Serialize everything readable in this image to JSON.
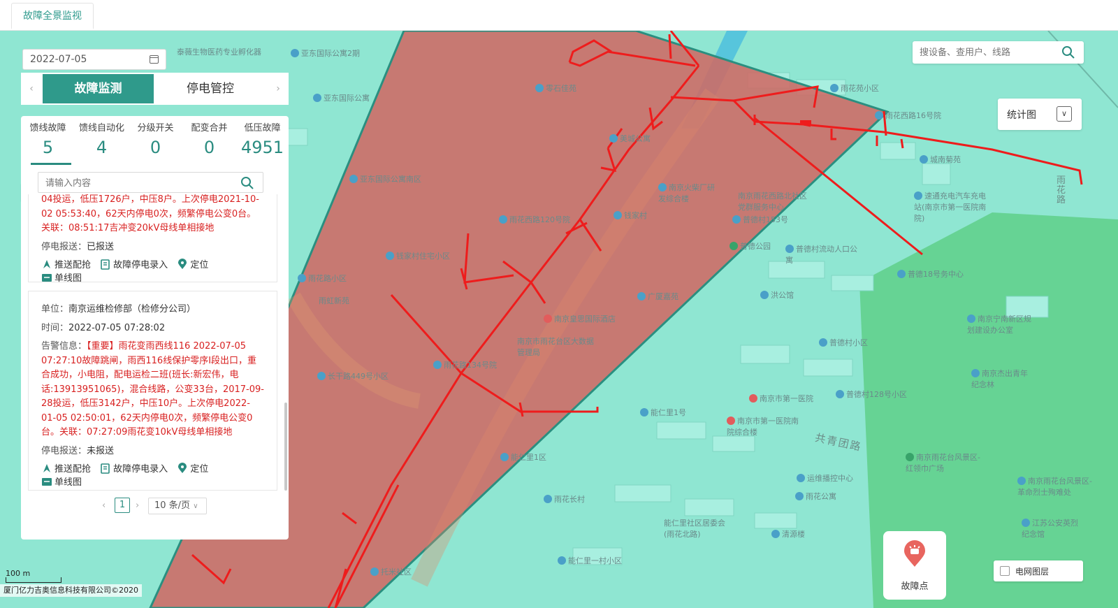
{
  "topbar": {
    "tab_label": "故障全景监视"
  },
  "date_picker": {
    "value": "2022-07-05",
    "icon": "calendar-icon"
  },
  "map_search": {
    "placeholder": "搜设备、查用户、线路",
    "icon": "search-icon"
  },
  "stat_view": {
    "label": "统计图",
    "icon": "chevron-down-icon"
  },
  "panel": {
    "tabs": [
      {
        "label": "故障监测",
        "active": true
      },
      {
        "label": "停电管控",
        "active": false
      }
    ],
    "prev_icon": "chevron-left-icon",
    "next_icon": "chevron-right-icon",
    "stats": [
      {
        "label": "馈线故障",
        "value": "5",
        "active": true
      },
      {
        "label": "馈线自动化",
        "value": "4"
      },
      {
        "label": "分级开关",
        "value": "0"
      },
      {
        "label": "配变合并",
        "value": "0"
      },
      {
        "label": "低压故障",
        "value": "4951"
      }
    ],
    "list_search": {
      "placeholder": "请输入内容"
    },
    "items": [
      {
        "alarm_tail": "04投运，低压1726户，中压8户。上次停电2021-10-02 05:53:40，62天内停电0次，频繁停电公变0台。关联：08:51:17吉冲变20kV母线单相接地",
        "report_label": "停电报送：",
        "report_value": "已报送"
      },
      {
        "unit_label": "单位：",
        "unit_value": "南京运维检修部（检修分公司）",
        "time_label": "时间：",
        "time_value": "2022-07-05 07:28:02",
        "alarm_label": "告警信息：",
        "alarm_value": "【重要】雨花变雨西线116 2022-07-05 07:27:10故障跳闸，雨西116线保护零序Ⅰ段出口，重合成功，小电阻，配电运检二班(班长:新宏伟，电话:13913951065)，混合线路，公变33台，2017-09-28投运，低压3142户，中压10户。上次停电2022-01-05 02:50:01，62天内停电0次，频繁停电公变0台。关联：07:27:09雨花变10kV母线单相接地",
        "report_label": "停电报送：",
        "report_value": "未报送"
      }
    ],
    "actions": [
      {
        "label": "推送配抢",
        "icon": "dispatch-icon"
      },
      {
        "label": "故障停电录入",
        "icon": "record-entry-icon"
      },
      {
        "label": "定位",
        "icon": "location-pin-icon"
      },
      {
        "label": "单线图",
        "icon": "single-line-diagram-icon"
      }
    ],
    "pagination": {
      "current": "1",
      "page_size": "10 条/页"
    }
  },
  "fault_button": {
    "label": "故障点",
    "icon": "fault-alarm-pin-icon"
  },
  "layer_toggle": {
    "label": "电网图层",
    "checked": false
  },
  "scale": {
    "label": "100 m"
  },
  "copyright": "厦门亿力吉奥信息科技有限公司©2020",
  "map_labels": {
    "pois": [
      "泰薇生物医药专业孵化器",
      "亚东国际公寓2期",
      "亚东国际公寓",
      "零石佳苑",
      "雨花苑小区",
      "雨花西路16号院",
      "美城公寓",
      "亚东国际公寓南区",
      "南京火柴厂研发综合楼",
      "钱家村",
      "雨花西路120号院",
      "普德村153号",
      "普德公园",
      "普德村流动人口公寓",
      "速通充电汽车充电站(南京市第一医院南院)",
      "城南菊苑",
      "南京雨花西路北社区党群服务中心",
      "钱家村住宅小区",
      "雨花路小区",
      "洪公馆",
      "普德18号务中心",
      "南京市雨花台区大数据管理局",
      "南京皇思国际酒店",
      "雨虹新苑",
      "普德村小区",
      "南京宁南新区规划建设办公室",
      "南京市第一医院",
      "南京市第一医院南院综合楼",
      "普德村128号小区",
      "能仁里1号",
      "南京杰出青年纪念林",
      "南京雨花台风景区-红领巾广场",
      "运维播控中心",
      "雨花公寓",
      "能仁里1区",
      "南京雨花台风景区-革命烈士殉难处",
      "雨花长村",
      "能仁里社区居委会(雨花北路)",
      "清源楼",
      "江苏公安英烈纪念馆",
      "托米社区",
      "能仁里一村小区",
      "长干路449号小区",
      "雨花路134号院",
      "广厦嘉苑"
    ],
    "roads": [
      "共青团路",
      "雨花路"
    ]
  }
}
